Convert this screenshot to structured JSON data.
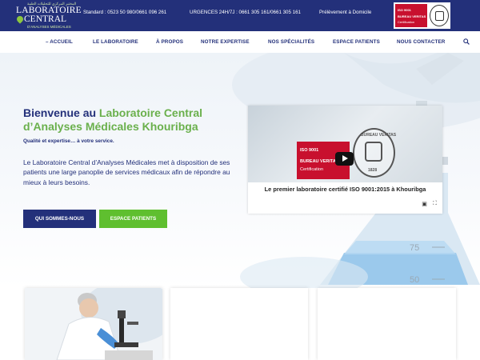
{
  "header": {
    "logo": {
      "arabic": "المختبر المركزي للتحليلات الطبية",
      "line1": "LABORATOIRE",
      "line2": "CENTRAL",
      "line3": "D'ANALYSES MÉDICALES"
    },
    "standard": "Standard : 0523 50 980/0661 096 261",
    "urgences": "URGENCES 24H/7J : 0661 305 161/0661 305 161",
    "prelevement": "Prélèvement à Domicile",
    "cert": {
      "iso": "ISO 9001",
      "bureau": "BUREAU VERITAS",
      "certification": "Certification"
    }
  },
  "nav": {
    "items": [
      "– ACCUEIL",
      "LE LABORATOIRE",
      "À PROPOS",
      "NOTRE EXPERTISE",
      "NOS SPÉCIALITÉS",
      "ESPACE PATIENTS",
      "NOUS CONTACTER"
    ],
    "search_icon": "search-icon"
  },
  "hero": {
    "welcome_prefix": "Bienvenue au ",
    "welcome_highlight": "Laboratoire Central d’Analyses Médicales Khouribga",
    "tagline": "Qualité et expertise… à votre service.",
    "description": "Le Laboratoire Central d’Analyses Médicales met à disposition de ses patients une large panoplie de services médicaux afin de répondre au mieux à leurs besoins.",
    "btn_about": "QUI SOMMES-NOUS",
    "btn_patients": "ESPACE PATIENTS",
    "beaker_marks": [
      "75",
      "50"
    ]
  },
  "video": {
    "iso": "ISO 9001",
    "bureau": "BUREAU VERITAS",
    "certification": "Certification",
    "seal_top": "BUREAU VERITAS",
    "seal_year": "1828",
    "caption": "Le premier laboratoire certifié ISO 9001:2015 à Khouribga"
  },
  "colors": {
    "navy": "#23307a",
    "green": "#6ab04c",
    "button_green": "#5fbf2f",
    "red": "#c8102e"
  }
}
